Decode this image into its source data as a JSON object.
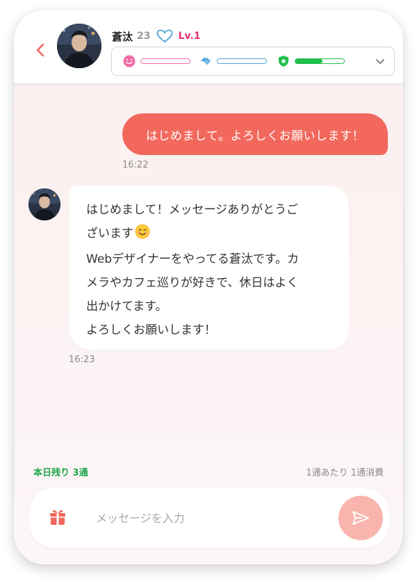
{
  "header": {
    "name": "蒼汰",
    "age": "23",
    "level": "Lv.1",
    "stats": [
      {
        "icon": "smile-icon",
        "color": "#f06ba8",
        "fill": 0.0
      },
      {
        "icon": "handshake-icon",
        "color": "#4aa3d8",
        "fill": 0.0
      },
      {
        "icon": "shield-star-icon",
        "color": "#1fbf4a",
        "fill": 0.55
      }
    ]
  },
  "messages": {
    "outgoing": {
      "text": "はじめまして。よろしくお願いします！",
      "time": "16:22"
    },
    "incoming": {
      "lines": [
        "はじめまして！メッセージありがとうご",
        "ざいます",
        "Webデザイナーをやってる蒼汰です。カ",
        "メラやカフェ巡りが好きで、休日はよく",
        "出かけてます。",
        "よろしくお願いします！"
      ],
      "time": "16:23"
    }
  },
  "footer": {
    "remaining": "本日残り 3通",
    "cost": "1通あたり 1通消費",
    "input_placeholder": "メッセージを入力"
  },
  "colors": {
    "accent": "#f2685c",
    "send": "#f9b5ad",
    "level": "#e8336a",
    "remaining": "#1ea548"
  }
}
